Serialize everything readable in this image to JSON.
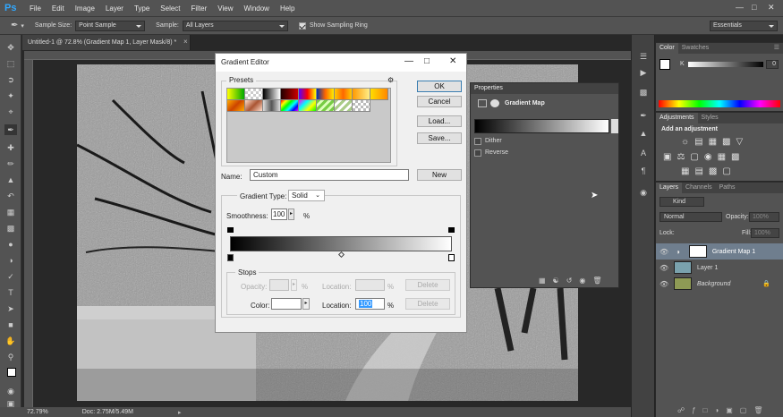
{
  "app": {
    "logo": "Ps",
    "menus": [
      "File",
      "Edit",
      "Image",
      "Layer",
      "Type",
      "Select",
      "Filter",
      "View",
      "Window",
      "Help"
    ]
  },
  "options": {
    "sample_size_label": "Sample Size:",
    "sample_size_value": "Point Sample",
    "sample_label": "Sample:",
    "sample_value": "All Layers",
    "ring_label": "Show Sampling Ring",
    "workspace": "Essentials"
  },
  "document": {
    "tab": "Untitled-1 @ 72.8% (Gradient Map 1, Layer Mask/8) *",
    "zoom": "72.79%",
    "doc_size": "Doc: 2.75M/5.49M"
  },
  "color_panel": {
    "tabs": [
      "Color",
      "Swatches"
    ],
    "k_label": "K",
    "k_value": "0",
    "percent": "%"
  },
  "adjustments_panel": {
    "tabs": [
      "Adjustments",
      "Styles"
    ],
    "heading": "Add an adjustment"
  },
  "layers_panel": {
    "tabs": [
      "Layers",
      "Channels",
      "Paths"
    ],
    "kind": "Kind",
    "blend_mode": "Normal",
    "opacity_label": "Opacity:",
    "opacity_value": "100%",
    "lock_label": "Lock:",
    "fill_label": "Fill:",
    "fill_value": "100%",
    "layers": [
      {
        "name": "Gradient Map 1"
      },
      {
        "name": "Layer 1"
      },
      {
        "name": "Background"
      }
    ]
  },
  "properties_panel": {
    "title": "Properties",
    "type": "Gradient Map",
    "dither": "Dither",
    "reverse": "Reverse"
  },
  "gradient_editor": {
    "title": "Gradient Editor",
    "presets_label": "Presets",
    "ok": "OK",
    "cancel": "Cancel",
    "load": "Load...",
    "save": "Save...",
    "name_label": "Name:",
    "name_value": "Custom",
    "new_button": "New",
    "gradient_type_label": "Gradient Type:",
    "gradient_type_value": "Solid",
    "smoothness_label": "Smoothness:",
    "smoothness_value": "100",
    "percent": "%",
    "stops_label": "Stops",
    "opacity_label": "Opacity:",
    "location_label": "Location:",
    "delete_label": "Delete",
    "color_label": "Color:",
    "location_value": "100"
  }
}
